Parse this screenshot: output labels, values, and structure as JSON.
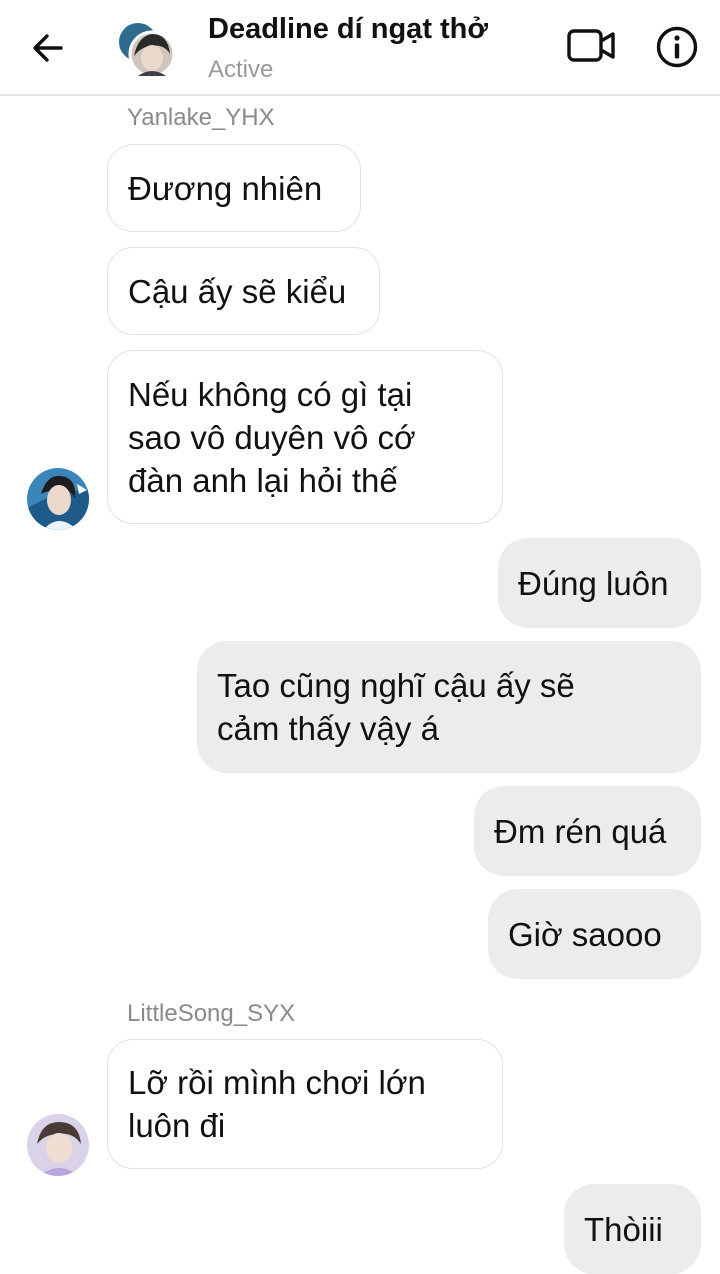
{
  "header": {
    "title": "Deadline dí ngạt thở",
    "status": "Active",
    "back_icon": "arrow-left-icon",
    "video_icon": "video-camera-icon",
    "info_icon": "info-icon"
  },
  "messages": [
    {
      "sender": "Yanlake_YHX",
      "text": "Đương nhiên",
      "direction": "incoming"
    },
    {
      "text": "Cậu ấy sẽ kiểu",
      "direction": "incoming"
    },
    {
      "text": "Nếu không có gì tại\nsao vô duyên vô cớ\nđàn anh lại hỏi thế",
      "direction": "incoming"
    },
    {
      "text": "Đúng luôn",
      "direction": "outgoing"
    },
    {
      "text": "Tao cũng nghĩ cậu ấy sẽ\ncảm thấy vậy á",
      "direction": "outgoing"
    },
    {
      "text": "Đm rén quá",
      "direction": "outgoing"
    },
    {
      "text": "Giờ saooo",
      "direction": "outgoing"
    },
    {
      "sender": "LittleSong_SYX",
      "text": "Lỡ rồi mình chơi lớn\nluôn đi",
      "direction": "incoming"
    },
    {
      "text": "Thòiii",
      "direction": "outgoing"
    }
  ],
  "colors": {
    "outgoing_bubble": "#ececec",
    "incoming_bubble": "#ffffff",
    "secondary_text": "#9a9a9a"
  }
}
